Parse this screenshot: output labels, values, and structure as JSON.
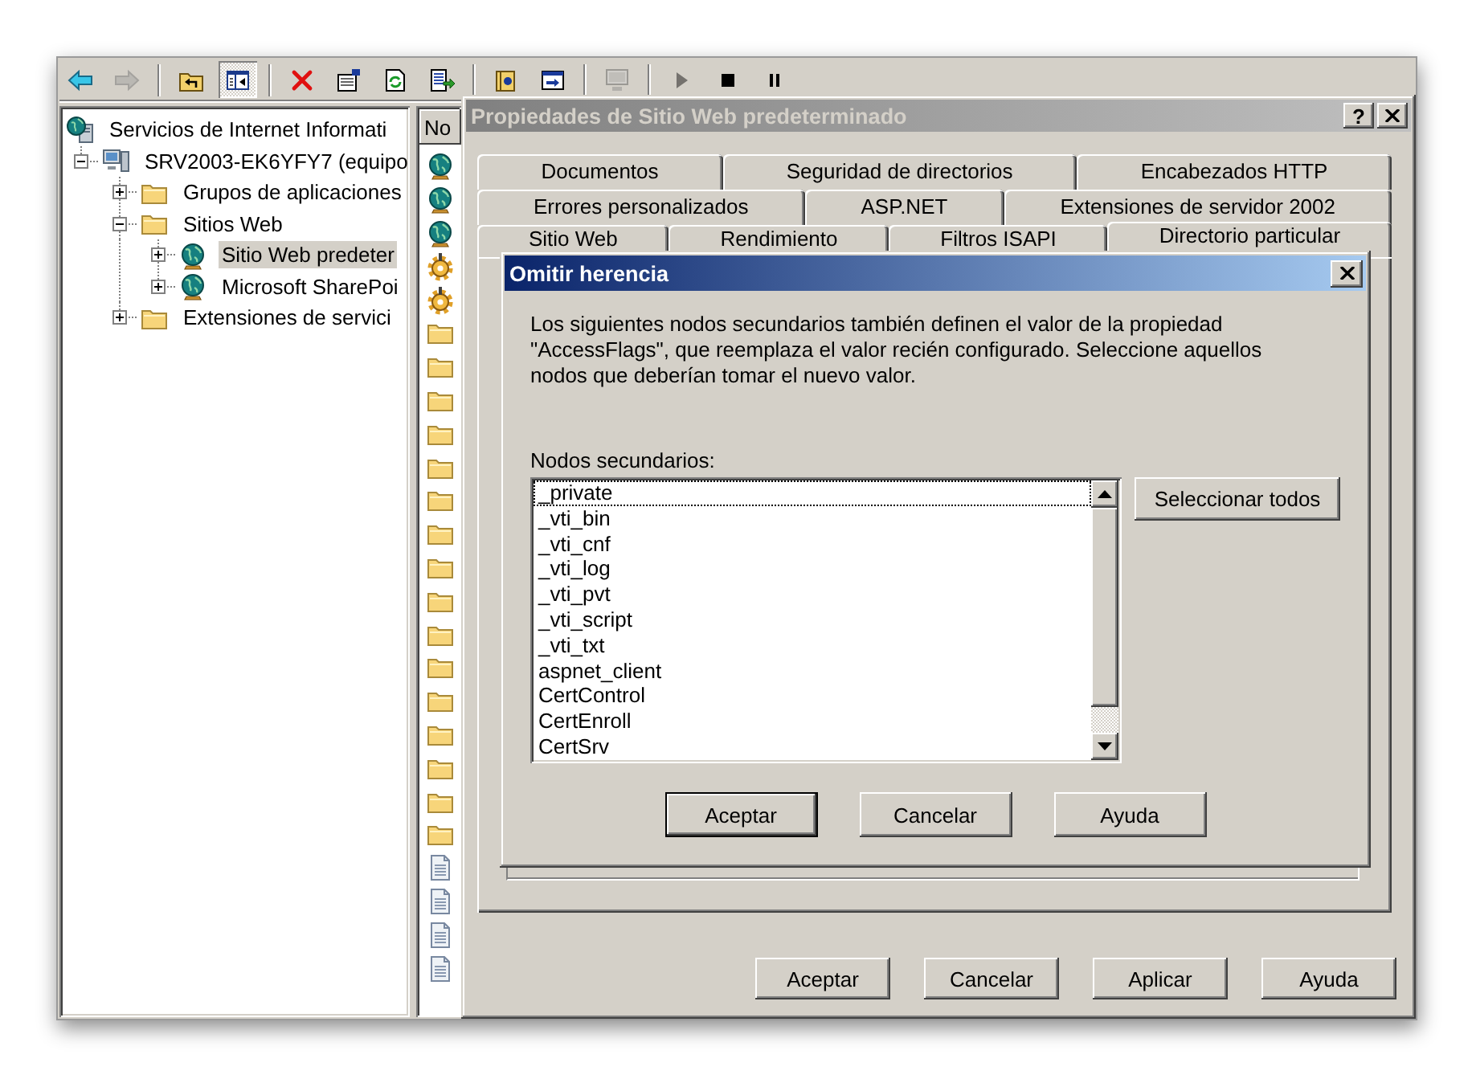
{
  "toolbar": {
    "groups": [
      {
        "buttons": [
          {
            "kind": "back",
            "disabled": false,
            "pressed": false
          },
          {
            "kind": "forward",
            "disabled": true,
            "pressed": false
          }
        ]
      },
      {
        "buttons": [
          {
            "kind": "up",
            "disabled": false,
            "pressed": false
          },
          {
            "kind": "tree",
            "disabled": false,
            "pressed": true
          }
        ]
      },
      {
        "buttons": [
          {
            "kind": "delete",
            "disabled": false,
            "pressed": false
          },
          {
            "kind": "properties",
            "disabled": false,
            "pressed": false
          },
          {
            "kind": "refresh",
            "disabled": false,
            "pressed": false
          },
          {
            "kind": "export",
            "disabled": false,
            "pressed": false
          }
        ]
      },
      {
        "buttons": [
          {
            "kind": "help",
            "disabled": false,
            "pressed": false
          },
          {
            "kind": "window",
            "disabled": false,
            "pressed": false
          }
        ]
      },
      {
        "buttons": [
          {
            "kind": "computer",
            "disabled": true,
            "pressed": false
          }
        ]
      },
      {
        "buttons": [
          {
            "kind": "play",
            "disabled": true,
            "pressed": false
          },
          {
            "kind": "stop",
            "disabled": false,
            "pressed": false
          },
          {
            "kind": "pause",
            "disabled": false,
            "pressed": false
          }
        ]
      }
    ]
  },
  "tree": {
    "root": {
      "label": "Servicios de Internet Informati",
      "kind": "services",
      "selected": false,
      "children": [
        {
          "label": "SRV2003-EK6YFY7 (equipo",
          "kind": "computer",
          "expanded": true,
          "selected": false,
          "children": [
            {
              "label": "Grupos de aplicaciones",
              "kind": "folder",
              "expanded": false,
              "selected": false
            },
            {
              "label": "Sitios Web",
              "kind": "folder",
              "expanded": true,
              "selected": false,
              "children": [
                {
                  "label": "Sitio Web predeter",
                  "kind": "globe",
                  "expanded": false,
                  "selected": true
                },
                {
                  "label": "Microsoft SharePoi",
                  "kind": "globe",
                  "expanded": false,
                  "selected": false
                }
              ]
            },
            {
              "label": "Extensiones de servici",
              "kind": "folder",
              "expanded": false,
              "selected": false
            }
          ]
        }
      ]
    }
  },
  "details_pane": {
    "columns": [
      {
        "label": "No"
      }
    ],
    "rows": [
      {
        "kind": "globe"
      },
      {
        "kind": "globe"
      },
      {
        "kind": "globe"
      },
      {
        "kind": "gear"
      },
      {
        "kind": "gear"
      },
      {
        "kind": "folder"
      },
      {
        "kind": "folder"
      },
      {
        "kind": "folder"
      },
      {
        "kind": "folder"
      },
      {
        "kind": "folder"
      },
      {
        "kind": "folder"
      },
      {
        "kind": "folder"
      },
      {
        "kind": "folder"
      },
      {
        "kind": "folder"
      },
      {
        "kind": "folder"
      },
      {
        "kind": "folder"
      },
      {
        "kind": "folder"
      },
      {
        "kind": "folder"
      },
      {
        "kind": "folder"
      },
      {
        "kind": "folder"
      },
      {
        "kind": "folder"
      },
      {
        "kind": "file"
      },
      {
        "kind": "file"
      },
      {
        "kind": "file"
      },
      {
        "kind": "file"
      }
    ]
  },
  "properties_dialog": {
    "title": "Propiedades de Sitio Web predeterminado",
    "active": false,
    "help_button": "?",
    "tab_rows": [
      {
        "tabs": [
          {
            "label": "Documentos",
            "selected": false
          },
          {
            "label": "Seguridad de directorios",
            "selected": false
          },
          {
            "label": "Encabezados HTTP",
            "selected": false
          }
        ]
      },
      {
        "tabs": [
          {
            "label": "Errores personalizados",
            "selected": false
          },
          {
            "label": "ASP.NET",
            "selected": false
          },
          {
            "label": "Extensiones de servidor 2002",
            "selected": false
          }
        ]
      },
      {
        "tabs": [
          {
            "label": "Sitio Web",
            "selected": false
          },
          {
            "label": "Rendimiento",
            "selected": false
          },
          {
            "label": "Filtros ISAPI",
            "selected": false
          },
          {
            "label": "Directorio particular",
            "selected": true
          }
        ]
      }
    ],
    "buttons": [
      {
        "label": "Aceptar",
        "default": false
      },
      {
        "label": "Cancelar",
        "default": false
      },
      {
        "label": "Aplicar",
        "default": false
      },
      {
        "label": "Ayuda",
        "default": false
      }
    ]
  },
  "inherit_dialog": {
    "title": "Omitir herencia",
    "active": true,
    "message": "Los siguientes nodos secundarios también definen el valor de la propiedad\n\"AccessFlags\", que reemplaza el valor recién configurado. Seleccione aquellos\nnodos que deberían tomar el nuevo valor.",
    "list_label": "Nodos secundarios:",
    "nodes": [
      {
        "label": "_private",
        "focused": true,
        "selected": false
      },
      {
        "label": "_vti_bin",
        "focused": false,
        "selected": false
      },
      {
        "label": "_vti_cnf",
        "focused": false,
        "selected": false
      },
      {
        "label": "_vti_log",
        "focused": false,
        "selected": false
      },
      {
        "label": "_vti_pvt",
        "focused": false,
        "selected": false
      },
      {
        "label": "_vti_script",
        "focused": false,
        "selected": false
      },
      {
        "label": "_vti_txt",
        "focused": false,
        "selected": false
      },
      {
        "label": "aspnet_client",
        "focused": false,
        "selected": false
      },
      {
        "label": "CertControl",
        "focused": false,
        "selected": false
      },
      {
        "label": "CertEnroll",
        "focused": false,
        "selected": false
      },
      {
        "label": "CertSrv",
        "focused": false,
        "selected": false
      }
    ],
    "select_all_button": "Seleccionar todos",
    "buttons": [
      {
        "label": "Aceptar",
        "default": true
      },
      {
        "label": "Cancelar",
        "default": false
      },
      {
        "label": "Ayuda",
        "default": false
      }
    ]
  }
}
